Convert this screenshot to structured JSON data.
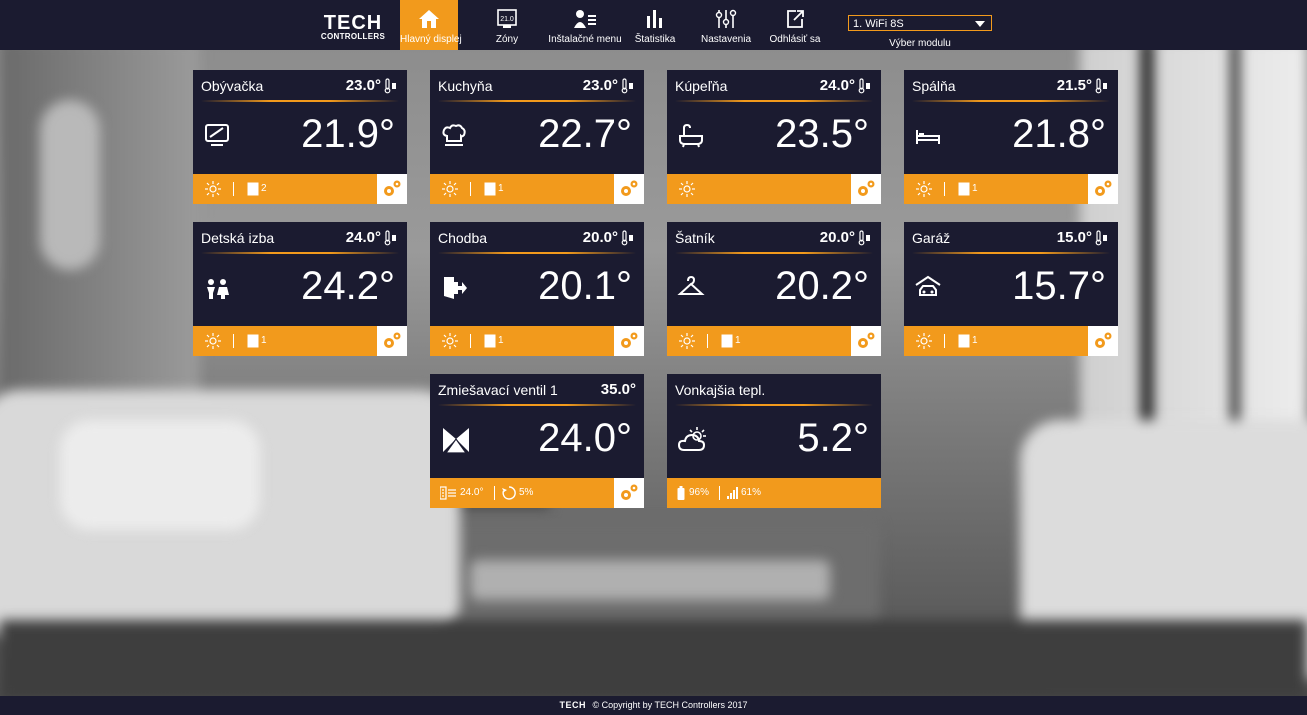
{
  "brand": {
    "line1": "TECH",
    "line2": "CONTROLLERS"
  },
  "nav": {
    "items": [
      {
        "label": "Hlavný displej",
        "icon": "home-icon",
        "active": true
      },
      {
        "label": "Zóny",
        "icon": "zones-display-icon",
        "badge": "21.0"
      },
      {
        "label": "Inštalačné menu",
        "icon": "installer-menu-icon"
      },
      {
        "label": "Štatistika",
        "icon": "statistics-bars-icon"
      },
      {
        "label": "Nastavenia",
        "icon": "settings-sliders-icon"
      },
      {
        "label": "Odhlásiť sa",
        "icon": "logout-icon"
      }
    ]
  },
  "module": {
    "selected": "1. WiFi 8S",
    "label": "Výber modulu"
  },
  "zones": [
    {
      "name": "Obývačka",
      "setpoint": "23.0°",
      "current": "21.9°",
      "icon": "tv-icon",
      "windows": "2"
    },
    {
      "name": "Kuchyňa",
      "setpoint": "23.0°",
      "current": "22.7°",
      "icon": "chef-hat-icon",
      "windows": "1"
    },
    {
      "name": "Kúpeľňa",
      "setpoint": "24.0°",
      "current": "23.5°",
      "icon": "bathtub-icon",
      "windows": ""
    },
    {
      "name": "Spálňa",
      "setpoint": "21.5°",
      "current": "21.8°",
      "icon": "bed-icon",
      "windows": "1"
    },
    {
      "name": "Detská izba",
      "setpoint": "24.0°",
      "current": "24.2°",
      "icon": "children-icon",
      "windows": "1"
    },
    {
      "name": "Chodba",
      "setpoint": "20.0°",
      "current": "20.1°",
      "icon": "door-exit-icon",
      "windows": "1"
    },
    {
      "name": "Šatník",
      "setpoint": "20.0°",
      "current": "20.2°",
      "icon": "hanger-icon",
      "windows": "1"
    },
    {
      "name": "Garáž",
      "setpoint": "15.0°",
      "current": "15.7°",
      "icon": "garage-car-icon",
      "windows": "1"
    }
  ],
  "valve": {
    "name": "Zmiešavací ventil 1",
    "setpoint": "35.0°",
    "current": "24.0°",
    "icon": "valve-icon",
    "return_temp": "24.0°",
    "opening": "5%"
  },
  "outdoor": {
    "name": "Vonkajšia tepl.",
    "current": "5.2°",
    "icon": "partly-cloudy-icon",
    "battery": "96%",
    "signal": "61%"
  },
  "footer": {
    "logo": "TECH",
    "text": "© Copyright by TECH Controllers 2017"
  },
  "colors": {
    "navy": "#1b1b30",
    "accent": "#f29a1c",
    "white": "#ffffff"
  }
}
